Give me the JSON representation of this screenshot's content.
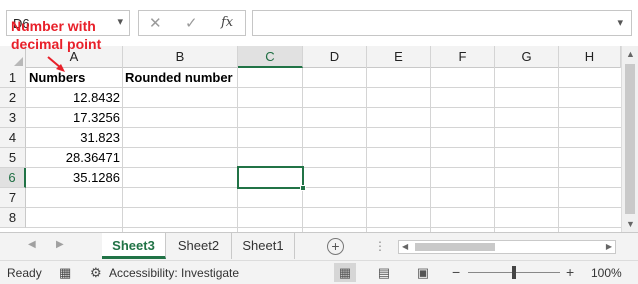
{
  "formula_bar": {
    "name_box": "D6",
    "cancel_icon": "✕",
    "enter_icon": "✓",
    "fx_label": "fx",
    "formula": ""
  },
  "annotation": {
    "text_line1": "Number with",
    "text_line2": "decimal point",
    "color": "#e8202a"
  },
  "grid": {
    "columns": [
      "A",
      "B",
      "C",
      "D",
      "E",
      "F",
      "G",
      "H"
    ],
    "active_column": "C",
    "rows": [
      "1",
      "2",
      "3",
      "4",
      "5",
      "6",
      "7",
      "8"
    ],
    "active_row": "6",
    "header_a1": "Numbers",
    "header_b1": "Rounded number",
    "values": [
      "12.8432",
      "17.3256",
      "31.823",
      "28.36471",
      "35.1286"
    ]
  },
  "sheets": {
    "tabs": [
      "Sheet3",
      "Sheet2",
      "Sheet1"
    ],
    "active": "Sheet3",
    "add_icon": "+",
    "accent": "#217346"
  },
  "status_bar": {
    "ready": "Ready",
    "accessibility": "Accessibility: Investigate",
    "zoom_minus": "−",
    "zoom_plus": "+",
    "zoom_level": "100%",
    "zoom_fraction": 0.5
  }
}
